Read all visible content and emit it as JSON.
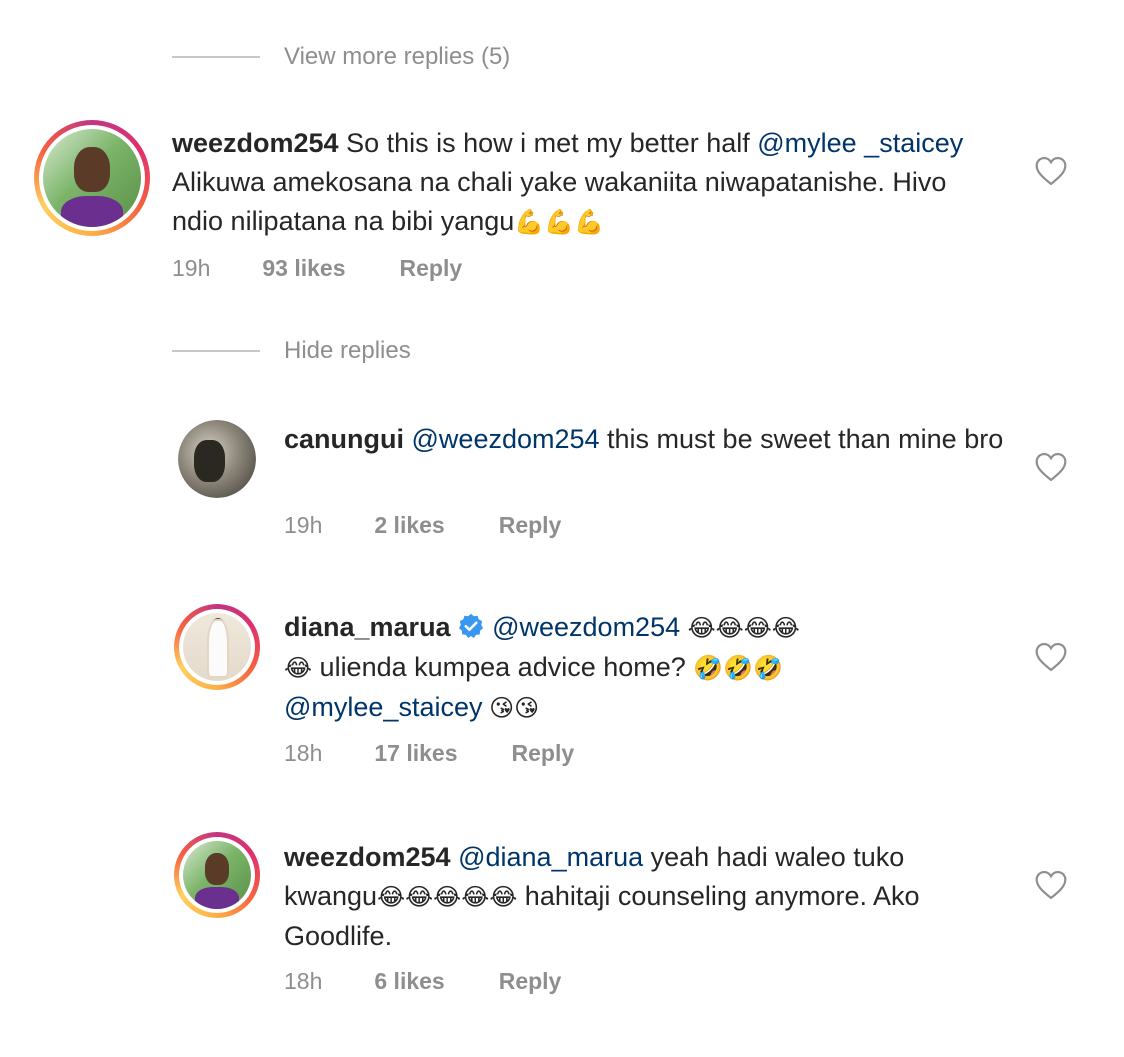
{
  "toggles": {
    "view_more": "View more replies (5)",
    "hide": "Hide replies"
  },
  "comments": [
    {
      "username": "weezdom254",
      "text_parts": [
        " So this is how i met my better half ",
        "@mylee _staicey",
        " Alikuwa amekosana na chali yake wakaniita niwapatanishe. Hivo ndio nilipatana na bibi yangu",
        "💪💪💪"
      ],
      "time": "19h",
      "likes": "93 likes",
      "reply": "Reply"
    },
    {
      "username": "canungui",
      "text_parts": [
        " ",
        "@weezdom254",
        " this must be sweet than mine bro"
      ],
      "time": "19h",
      "likes": "2 likes",
      "reply": "Reply"
    },
    {
      "username": "diana_marua",
      "verified": true,
      "text_parts": [
        "@weezdom254",
        "😂😂😂😂",
        "😂",
        " ulienda kumpea advice home? ",
        "🤣🤣🤣",
        "@mylee_staicey",
        " 😘😘"
      ],
      "time": "18h",
      "likes": "17 likes",
      "reply": "Reply"
    },
    {
      "username": "weezdom254",
      "text_parts": [
        " ",
        "@diana_marua",
        " yeah hadi waleo tuko kwangu",
        "😂😂😂😂😂",
        " hahitaji counseling anymore. Ako Goodlife."
      ],
      "time": "18h",
      "likes": "6 likes",
      "reply": "Reply"
    }
  ],
  "colors": {
    "text": "#262626",
    "secondary": "#8e8e8e",
    "mention": "#003569",
    "verified": "#3897f0"
  },
  "icons": {
    "like": "heart-outline-icon",
    "verified": "verified-badge-icon"
  }
}
